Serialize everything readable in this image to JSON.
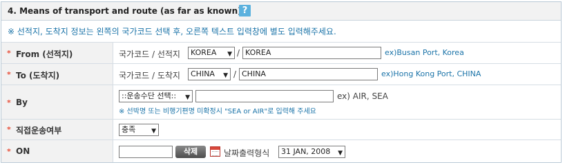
{
  "header": {
    "title": "4. Means of transport and route (as far as known)",
    "help_icon": "?"
  },
  "notice": "※ 선적지, 도착지 정보는 왼쪽의 국가코드 선택 후, 오른쪽 텍스트 입력창에 별도 입력해주세요.",
  "rows": {
    "from": {
      "label": "From (선적지)",
      "code_label": "국가코드 / 선적지",
      "country_select": "KOREA",
      "slash": "/",
      "place_input": "KOREA",
      "example": "ex)Busan Port, Korea"
    },
    "to": {
      "label": "To (도착지)",
      "code_label": "국가코드 / 도착지",
      "country_select": "CHINA",
      "slash": "/",
      "place_input": "CHINA",
      "example": "ex)Hong Kong Port, CHINA"
    },
    "by": {
      "label": "By",
      "transport_select": "::운송수단 선택::",
      "transport_input": "",
      "example": "ex) AIR, SEA",
      "note": "※ 선박명 또는 비행기편명 미확정시 \"SEA or AIR\"로 입력해 주세요"
    },
    "direct": {
      "label": "직접운송여부",
      "select": "충족"
    },
    "on": {
      "label": "ON",
      "date_input": "",
      "delete_button": "삭제",
      "format_label": "날짜출력형식",
      "format_select": "31 JAN, 2008"
    }
  },
  "required_mark": "*"
}
